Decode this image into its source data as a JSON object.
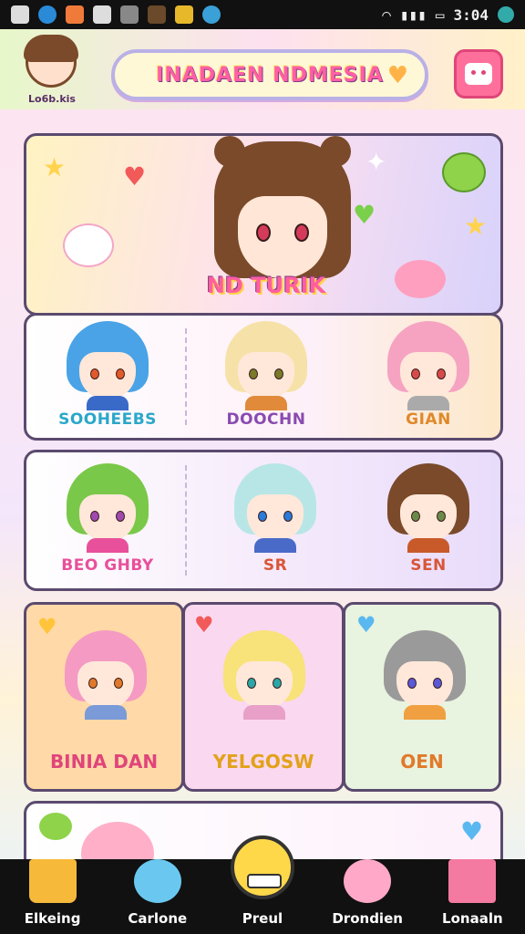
{
  "status_bar": {
    "time": "3:04"
  },
  "header": {
    "avatar_label": "Lo6b.kis",
    "title": "INADAEN NDMESIA",
    "colors": {
      "accent": "#ff5fa6",
      "menu": "#ff6f9c"
    }
  },
  "hero": {
    "name": "ND TURIK"
  },
  "row1": [
    {
      "name": "SOOHEEBS",
      "color": "#2aa7c9"
    },
    {
      "name": "DOOCHN",
      "color": "#8a4ab0"
    },
    {
      "name": "GIAN",
      "color": "#e0892a"
    }
  ],
  "row2": [
    {
      "name": "BEO GHBY",
      "color": "#e8509b"
    },
    {
      "name": "SR",
      "color": "#d8563a"
    },
    {
      "name": "SEN",
      "color": "#d8563a"
    }
  ],
  "row3": [
    {
      "name": "BINIA DAN",
      "color": "#e0457a"
    },
    {
      "name": "YELGOSW",
      "color": "#e2a21a"
    },
    {
      "name": "OEN",
      "color": "#e07a2a"
    }
  ],
  "bottom_nav": [
    {
      "label": "Elkeing",
      "icon": "house-icon"
    },
    {
      "label": "Carlone",
      "icon": "cat-icon"
    },
    {
      "label": "Preul",
      "icon": "smiley-icon"
    },
    {
      "label": "Drondien",
      "icon": "pig-icon"
    },
    {
      "label": "Lonaaln",
      "icon": "building-icon"
    }
  ]
}
